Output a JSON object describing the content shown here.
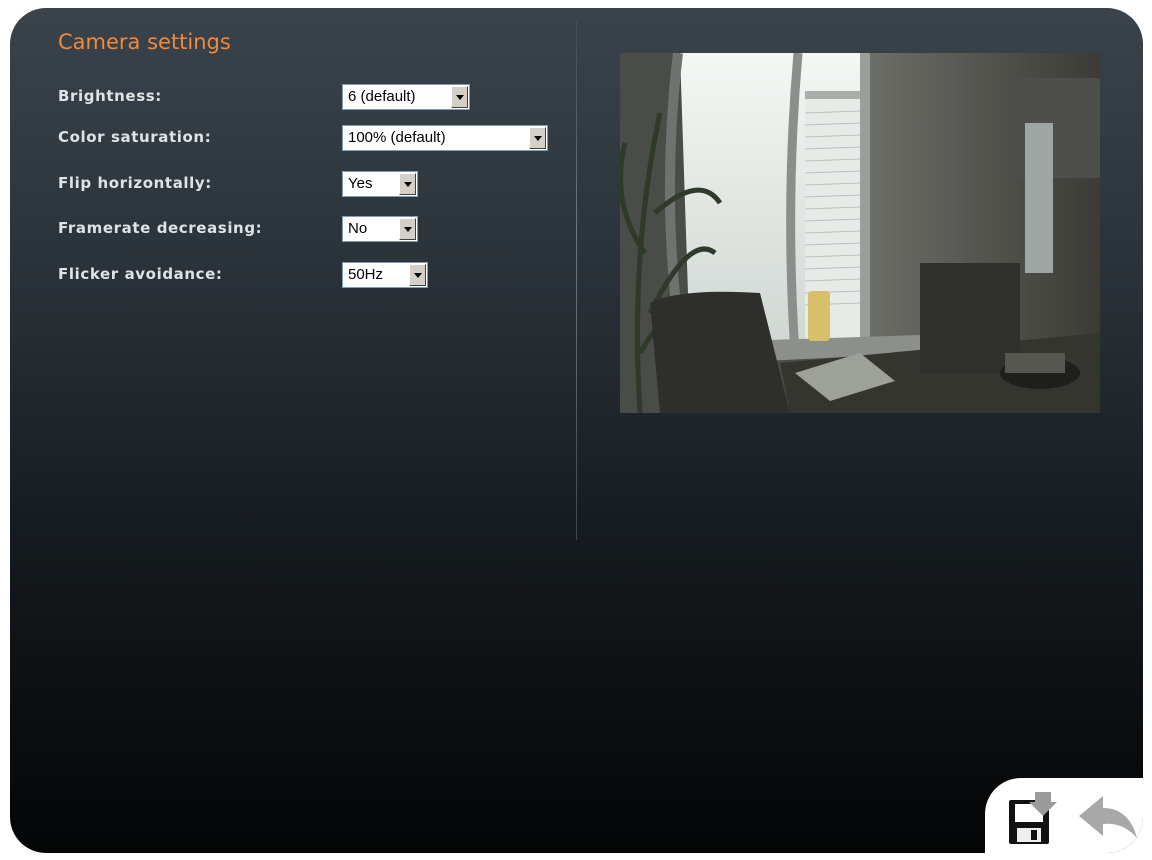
{
  "page": {
    "title": "Camera settings"
  },
  "settings": [
    {
      "label": "Brightness:",
      "value": "6 (default)"
    },
    {
      "label": "Color saturation:",
      "value": "100% (default)"
    },
    {
      "label": "Flip horizontally:",
      "value": "Yes"
    },
    {
      "label": "Framerate decreasing:",
      "value": "No"
    },
    {
      "label": "Flicker avoidance:",
      "value": "50Hz"
    }
  ],
  "preview": {
    "icon": "camera-preview-image"
  },
  "actions": {
    "save_icon": "save-floppy-icon",
    "back_icon": "back-arrow-icon"
  },
  "colors": {
    "title": "#f0893a",
    "label": "#dfe3e6",
    "panel_top": "#3a434b",
    "panel_bottom": "#040506"
  }
}
